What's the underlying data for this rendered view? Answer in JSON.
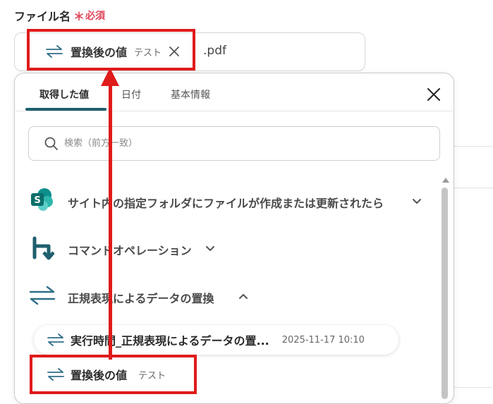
{
  "field": {
    "label": "ファイル名",
    "required_mark": "＊",
    "required_text": "必須",
    "chip": {
      "label": "置換後の値",
      "tag": "テスト"
    },
    "suffix": ".pdf"
  },
  "dropdown": {
    "tabs": [
      {
        "label": "取得した値",
        "active": true
      },
      {
        "label": "日付",
        "active": false
      },
      {
        "label": "基本情報",
        "active": false
      }
    ],
    "search_placeholder": "検索（前方一致）",
    "sections": [
      {
        "label": "サイト内の指定フォルダにファイルが作成または更新されたら",
        "icon": "sharepoint-icon",
        "expanded": false
      },
      {
        "label": "コマンドオペレーション",
        "icon": "command-operation-icon",
        "expanded": false
      },
      {
        "label": "正規表現によるデータの置換",
        "icon": "swap-arrows-icon",
        "expanded": true
      }
    ],
    "items": [
      {
        "label": "実行時間_正規表現によるデータの置...",
        "value": "2025-11-17 10:10"
      },
      {
        "label": "置換後の値",
        "value": "テスト"
      }
    ]
  },
  "colors": {
    "accent": "#1f5f6e",
    "required": "#e0455a",
    "annotation": "#e01b1b",
    "sharepoint": "#0b7a76"
  }
}
